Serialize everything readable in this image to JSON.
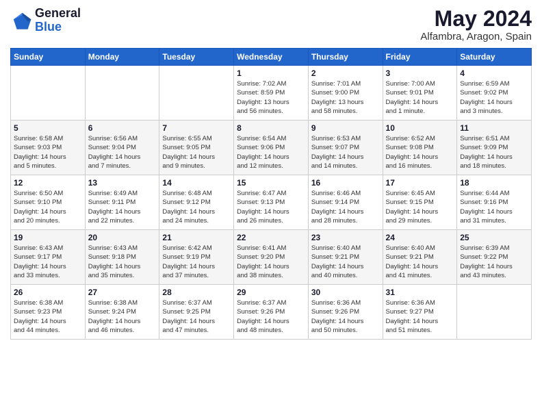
{
  "header": {
    "logo_line1": "General",
    "logo_line2": "Blue",
    "month_title": "May 2024",
    "location": "Alfambra, Aragon, Spain"
  },
  "days_of_week": [
    "Sunday",
    "Monday",
    "Tuesday",
    "Wednesday",
    "Thursday",
    "Friday",
    "Saturday"
  ],
  "weeks": [
    [
      {
        "day": "",
        "info": ""
      },
      {
        "day": "",
        "info": ""
      },
      {
        "day": "",
        "info": ""
      },
      {
        "day": "1",
        "info": "Sunrise: 7:02 AM\nSunset: 8:59 PM\nDaylight: 13 hours\nand 56 minutes."
      },
      {
        "day": "2",
        "info": "Sunrise: 7:01 AM\nSunset: 9:00 PM\nDaylight: 13 hours\nand 58 minutes."
      },
      {
        "day": "3",
        "info": "Sunrise: 7:00 AM\nSunset: 9:01 PM\nDaylight: 14 hours\nand 1 minute."
      },
      {
        "day": "4",
        "info": "Sunrise: 6:59 AM\nSunset: 9:02 PM\nDaylight: 14 hours\nand 3 minutes."
      }
    ],
    [
      {
        "day": "5",
        "info": "Sunrise: 6:58 AM\nSunset: 9:03 PM\nDaylight: 14 hours\nand 5 minutes."
      },
      {
        "day": "6",
        "info": "Sunrise: 6:56 AM\nSunset: 9:04 PM\nDaylight: 14 hours\nand 7 minutes."
      },
      {
        "day": "7",
        "info": "Sunrise: 6:55 AM\nSunset: 9:05 PM\nDaylight: 14 hours\nand 9 minutes."
      },
      {
        "day": "8",
        "info": "Sunrise: 6:54 AM\nSunset: 9:06 PM\nDaylight: 14 hours\nand 12 minutes."
      },
      {
        "day": "9",
        "info": "Sunrise: 6:53 AM\nSunset: 9:07 PM\nDaylight: 14 hours\nand 14 minutes."
      },
      {
        "day": "10",
        "info": "Sunrise: 6:52 AM\nSunset: 9:08 PM\nDaylight: 14 hours\nand 16 minutes."
      },
      {
        "day": "11",
        "info": "Sunrise: 6:51 AM\nSunset: 9:09 PM\nDaylight: 14 hours\nand 18 minutes."
      }
    ],
    [
      {
        "day": "12",
        "info": "Sunrise: 6:50 AM\nSunset: 9:10 PM\nDaylight: 14 hours\nand 20 minutes."
      },
      {
        "day": "13",
        "info": "Sunrise: 6:49 AM\nSunset: 9:11 PM\nDaylight: 14 hours\nand 22 minutes."
      },
      {
        "day": "14",
        "info": "Sunrise: 6:48 AM\nSunset: 9:12 PM\nDaylight: 14 hours\nand 24 minutes."
      },
      {
        "day": "15",
        "info": "Sunrise: 6:47 AM\nSunset: 9:13 PM\nDaylight: 14 hours\nand 26 minutes."
      },
      {
        "day": "16",
        "info": "Sunrise: 6:46 AM\nSunset: 9:14 PM\nDaylight: 14 hours\nand 28 minutes."
      },
      {
        "day": "17",
        "info": "Sunrise: 6:45 AM\nSunset: 9:15 PM\nDaylight: 14 hours\nand 29 minutes."
      },
      {
        "day": "18",
        "info": "Sunrise: 6:44 AM\nSunset: 9:16 PM\nDaylight: 14 hours\nand 31 minutes."
      }
    ],
    [
      {
        "day": "19",
        "info": "Sunrise: 6:43 AM\nSunset: 9:17 PM\nDaylight: 14 hours\nand 33 minutes."
      },
      {
        "day": "20",
        "info": "Sunrise: 6:43 AM\nSunset: 9:18 PM\nDaylight: 14 hours\nand 35 minutes."
      },
      {
        "day": "21",
        "info": "Sunrise: 6:42 AM\nSunset: 9:19 PM\nDaylight: 14 hours\nand 37 minutes."
      },
      {
        "day": "22",
        "info": "Sunrise: 6:41 AM\nSunset: 9:20 PM\nDaylight: 14 hours\nand 38 minutes."
      },
      {
        "day": "23",
        "info": "Sunrise: 6:40 AM\nSunset: 9:21 PM\nDaylight: 14 hours\nand 40 minutes."
      },
      {
        "day": "24",
        "info": "Sunrise: 6:40 AM\nSunset: 9:21 PM\nDaylight: 14 hours\nand 41 minutes."
      },
      {
        "day": "25",
        "info": "Sunrise: 6:39 AM\nSunset: 9:22 PM\nDaylight: 14 hours\nand 43 minutes."
      }
    ],
    [
      {
        "day": "26",
        "info": "Sunrise: 6:38 AM\nSunset: 9:23 PM\nDaylight: 14 hours\nand 44 minutes."
      },
      {
        "day": "27",
        "info": "Sunrise: 6:38 AM\nSunset: 9:24 PM\nDaylight: 14 hours\nand 46 minutes."
      },
      {
        "day": "28",
        "info": "Sunrise: 6:37 AM\nSunset: 9:25 PM\nDaylight: 14 hours\nand 47 minutes."
      },
      {
        "day": "29",
        "info": "Sunrise: 6:37 AM\nSunset: 9:26 PM\nDaylight: 14 hours\nand 48 minutes."
      },
      {
        "day": "30",
        "info": "Sunrise: 6:36 AM\nSunset: 9:26 PM\nDaylight: 14 hours\nand 50 minutes."
      },
      {
        "day": "31",
        "info": "Sunrise: 6:36 AM\nSunset: 9:27 PM\nDaylight: 14 hours\nand 51 minutes."
      },
      {
        "day": "",
        "info": ""
      }
    ]
  ]
}
